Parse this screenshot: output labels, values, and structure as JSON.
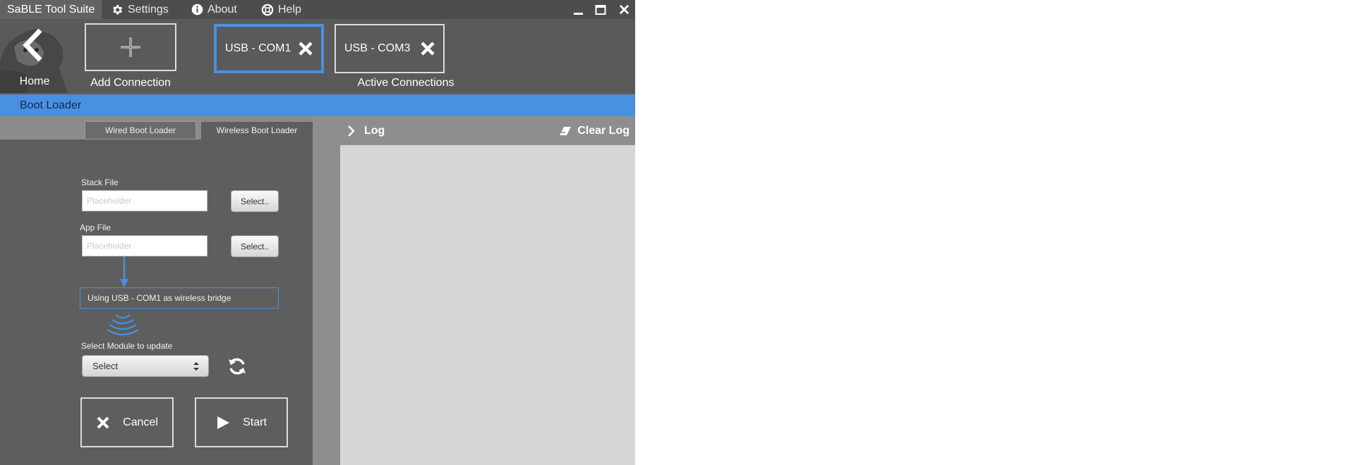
{
  "window": {
    "title": "SaBLE Tool Suite",
    "menu": [
      {
        "label": "Settings",
        "icon": "gear-icon"
      },
      {
        "label": "About",
        "icon": "info-icon"
      },
      {
        "label": "Help",
        "icon": "lifebuoy-icon"
      }
    ]
  },
  "toolbar": {
    "home_label": "Home",
    "add_connection_label": "Add Connection",
    "connections": [
      {
        "label": "USB - COM1",
        "active": true
      },
      {
        "label": "USB - COM3",
        "active": false
      }
    ],
    "active_connections_label": "Active Connections"
  },
  "section": {
    "title": "Boot Loader"
  },
  "tabs": {
    "wired": "Wired Boot Loader",
    "wireless": "Wireless Boot Loader",
    "selected": "wireless"
  },
  "form": {
    "stack_file_label": "Stack File",
    "stack_file_placeholder": "Placeholder",
    "stack_file_value": "",
    "app_file_label": "App File",
    "app_file_placeholder": "Placeholder",
    "app_file_value": "",
    "select_button_label": "Select..",
    "bridge_info": "Using USB - COM1 as wireless bridge",
    "module_label": "Select Module to update",
    "module_selected": "Select",
    "cancel_label": "Cancel",
    "start_label": "Start"
  },
  "log": {
    "title": "Log",
    "clear_label": "Clear Log"
  },
  "colors": {
    "accent": "#4a90e2",
    "panel": "#5e5e5e",
    "log_bg": "#d6d6d6"
  }
}
